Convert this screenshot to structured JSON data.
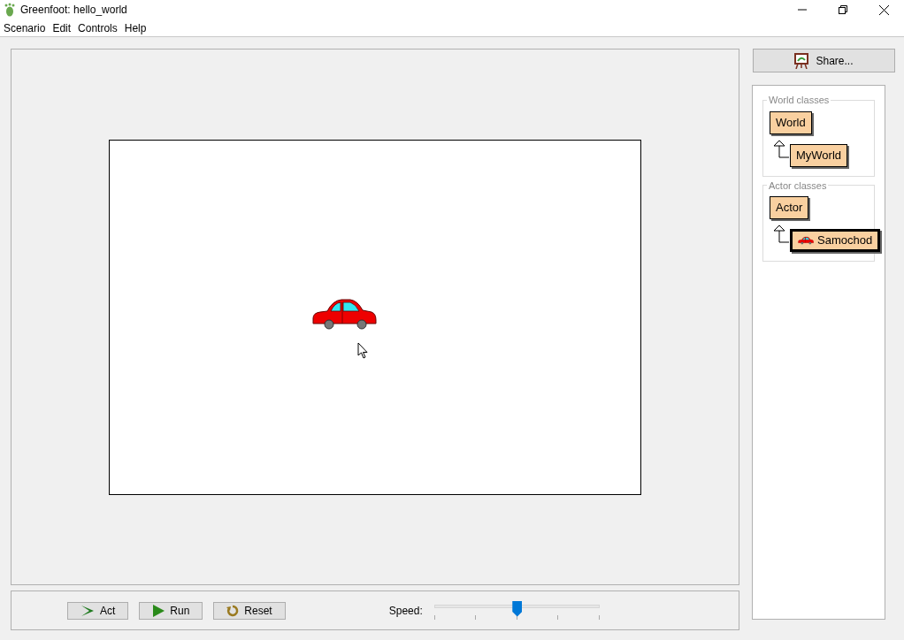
{
  "window": {
    "title": "Greenfoot: hello_world"
  },
  "menu": [
    "Scenario",
    "Edit",
    "Controls",
    "Help"
  ],
  "share_button": {
    "label": "Share..."
  },
  "class_groups": [
    {
      "title": "World classes",
      "classes": [
        {
          "name": "World",
          "kind": "plain",
          "selected": false,
          "children": [
            {
              "name": "MyWorld",
              "kind": "plain",
              "selected": false
            }
          ]
        }
      ]
    },
    {
      "title": "Actor classes",
      "classes": [
        {
          "name": "Actor",
          "kind": "plain",
          "selected": false,
          "children": [
            {
              "name": "Samochod",
              "kind": "image",
              "selected": true
            }
          ]
        }
      ]
    }
  ],
  "controls": [
    {
      "label": "Act",
      "kind": "act"
    },
    {
      "label": "Run",
      "kind": "run"
    },
    {
      "label": "Reset",
      "kind": "reset"
    }
  ],
  "speed": {
    "label": "Speed:",
    "level": 0.5
  }
}
